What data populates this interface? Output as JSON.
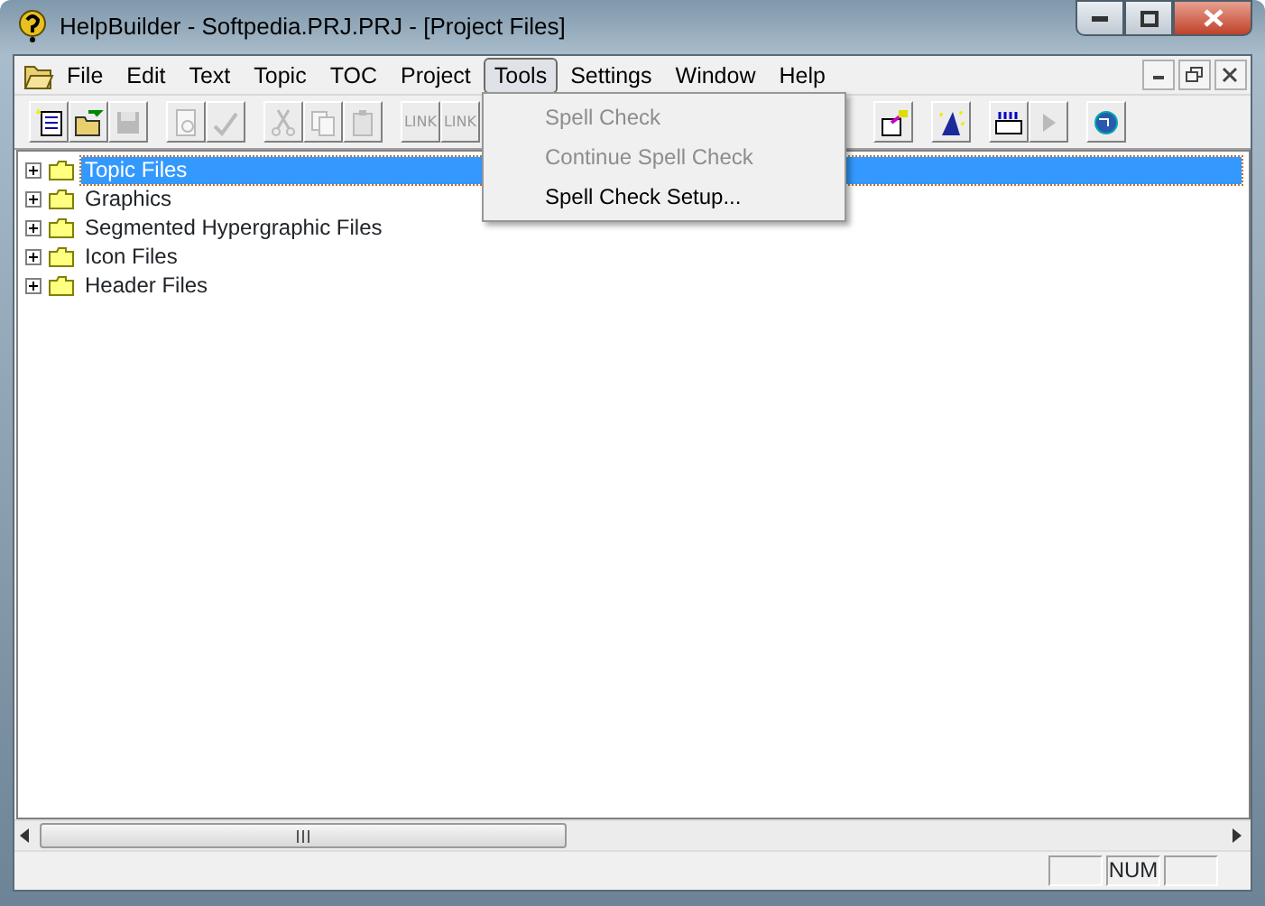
{
  "window": {
    "title": "HelpBuilder - Softpedia.PRJ.PRJ - [Project Files]"
  },
  "menu": [
    {
      "label": "File",
      "selected": false
    },
    {
      "label": "Edit",
      "selected": false
    },
    {
      "label": "Text",
      "selected": false
    },
    {
      "label": "Topic",
      "selected": false
    },
    {
      "label": "TOC",
      "selected": false
    },
    {
      "label": "Project",
      "selected": false
    },
    {
      "label": "Tools",
      "selected": true
    },
    {
      "label": "Settings",
      "selected": false
    },
    {
      "label": "Window",
      "selected": false
    },
    {
      "label": "Help",
      "selected": false
    }
  ],
  "toolbar": [
    {
      "kind": "new",
      "disabled": false
    },
    {
      "kind": "open",
      "disabled": false
    },
    {
      "kind": "save",
      "disabled": true
    },
    {
      "kind": "separator"
    },
    {
      "kind": "preview",
      "disabled": true
    },
    {
      "kind": "spell",
      "disabled": true
    },
    {
      "kind": "separator"
    },
    {
      "kind": "cut",
      "disabled": true
    },
    {
      "kind": "copy",
      "disabled": true
    },
    {
      "kind": "paste",
      "disabled": true
    },
    {
      "kind": "separator"
    },
    {
      "kind": "link",
      "label": "LINK",
      "disabled": true
    },
    {
      "kind": "link",
      "label": "LINK",
      "disabled": true
    }
  ],
  "toolbar_right": [
    {
      "kind": "export",
      "disabled": false
    },
    {
      "kind": "separator"
    },
    {
      "kind": "wizard",
      "disabled": false
    },
    {
      "kind": "separator"
    },
    {
      "kind": "keyboard",
      "disabled": false
    },
    {
      "kind": "play",
      "disabled": true
    },
    {
      "kind": "separator"
    },
    {
      "kind": "globe",
      "disabled": false
    }
  ],
  "dropdown": [
    {
      "label": "Spell Check",
      "disabled": true
    },
    {
      "label": "Continue Spell Check",
      "disabled": true
    },
    {
      "label": "Spell Check Setup...",
      "disabled": false
    }
  ],
  "tree": [
    {
      "label": "Topic Files",
      "selected": true,
      "expanded": false
    },
    {
      "label": "Graphics",
      "selected": false,
      "expanded": false
    },
    {
      "label": "Segmented Hypergraphic Files",
      "selected": false,
      "expanded": false
    },
    {
      "label": "Icon Files",
      "selected": false,
      "expanded": false
    },
    {
      "label": "Header Files",
      "selected": false,
      "expanded": false
    }
  ],
  "status_bar": {
    "num_indicator": "NUM"
  }
}
